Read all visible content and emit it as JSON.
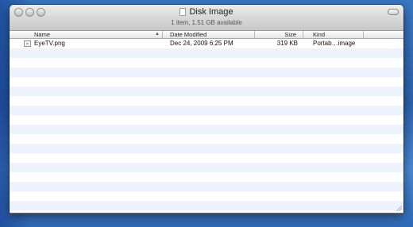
{
  "window": {
    "title": "Disk Image",
    "status": "1 item, 1.51 GB available"
  },
  "columns": {
    "name": "Name",
    "date_modified": "Date Modified",
    "size": "Size",
    "kind": "Kind"
  },
  "files": [
    {
      "name": "EyeTV.png",
      "date_modified": "Dec 24, 2009 6:25 PM",
      "size": "319 KB",
      "kind": "Portab…image",
      "icon": "image-file-icon"
    }
  ],
  "colors": {
    "stripe": "#edf3fe",
    "desktop": "#2a62b0"
  }
}
